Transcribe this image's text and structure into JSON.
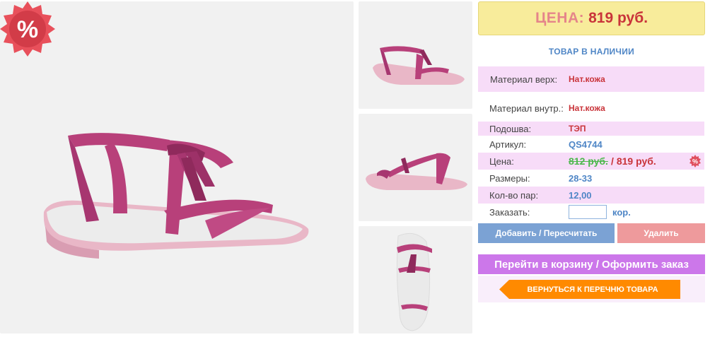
{
  "price_box": {
    "label": "ЦЕНА:",
    "value": "819 руб."
  },
  "stock_status": "ТОВАР В НАЛИЧИИ",
  "badge_symbol": "%",
  "specs": {
    "upper_label": "Материал верх:",
    "upper_value": "Нат.кожа",
    "inner_label": "Материал внутр.:",
    "inner_value": "Нат.кожа",
    "sole_label": "Подошва:",
    "sole_value": "ТЭП",
    "article_label": "Артикул:",
    "article_value": "QS4744",
    "price_label": "Цена:",
    "old_price": "812 руб.",
    "slash": "/",
    "new_price": "819 руб.",
    "sizes_label": "Размеры:",
    "sizes_value": "28-33",
    "pairs_label": "Кол-во пар:",
    "pairs_value": "12,00",
    "order_label": "Заказать:",
    "order_unit": "кор.",
    "order_value": ""
  },
  "buttons": {
    "add": "Добавить / Пересчитать",
    "delete": "Удалить",
    "cart": "Перейти в корзину / Оформить заказ",
    "back": "ВЕРНУТЬСЯ К ПЕРЕЧНЮ ТОВАРА"
  },
  "colors": {
    "price_bg": "#f8ec9b",
    "accent_red": "#c9343a",
    "link_blue": "#4f86c6",
    "row_pink": "#f7dcf8",
    "cart_purple": "#cc77ea",
    "back_orange": "#ff8a00",
    "sandal_pink": "#b8407a"
  },
  "icons": {
    "sale_badge": "percent-starburst-icon",
    "back_arrow": "left-arrow-shape"
  }
}
